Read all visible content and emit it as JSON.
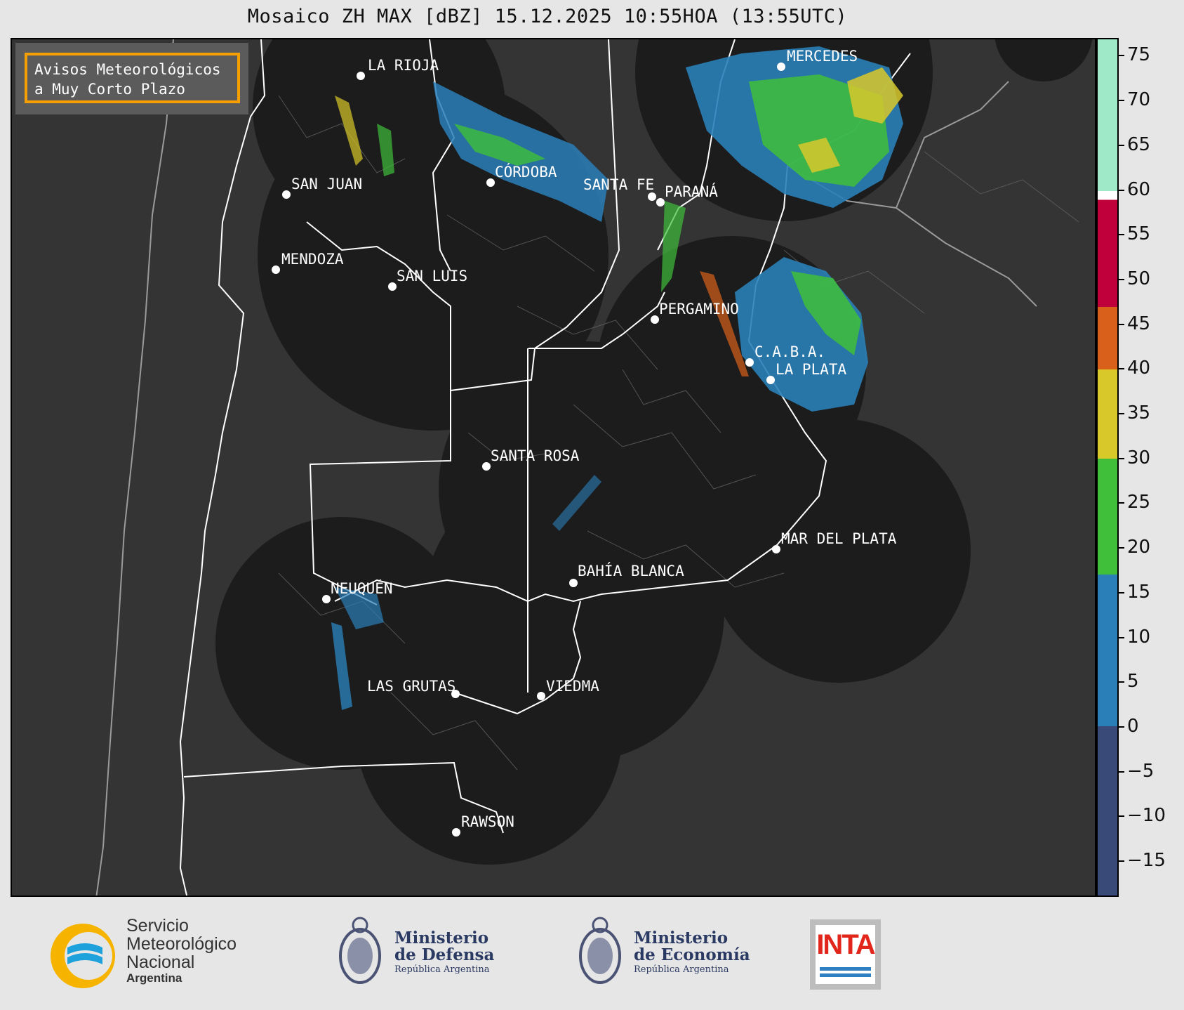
{
  "title": "Mosaico ZH MAX [dBZ] 15.12.2025 10:55HOA (13:55UTC)",
  "warning_box": {
    "line1": "Avisos Meteorológicos",
    "line2": "a Muy Corto Plazo"
  },
  "cities": [
    {
      "name": "LA RIOJA"
    },
    {
      "name": "SAN JUAN"
    },
    {
      "name": "CÓRDOBA"
    },
    {
      "name": "MENDOZA"
    },
    {
      "name": "SAN LUIS"
    },
    {
      "name": "SANTA FE"
    },
    {
      "name": "PARANÁ"
    },
    {
      "name": "MERCEDES"
    },
    {
      "name": "PERGAMINO"
    },
    {
      "name": "C.A.B.A."
    },
    {
      "name": "LA PLATA"
    },
    {
      "name": "SANTA ROSA"
    },
    {
      "name": "MAR DEL PLATA"
    },
    {
      "name": "BAHÍA BLANCA"
    },
    {
      "name": "NEUQUÉN"
    },
    {
      "name": "LAS GRUTAS"
    },
    {
      "name": "VIEDMA"
    },
    {
      "name": "RAWSON"
    }
  ],
  "colorbar": {
    "unit": "dBZ",
    "min": -19,
    "max": 77,
    "ticks": [
      "75",
      "70",
      "65",
      "60",
      "55",
      "50",
      "45",
      "40",
      "35",
      "30",
      "25",
      "20",
      "15",
      "10",
      "5",
      "0",
      "−5",
      "−10",
      "−15"
    ],
    "tick_values": [
      75,
      70,
      65,
      60,
      55,
      50,
      45,
      40,
      35,
      30,
      25,
      20,
      15,
      10,
      5,
      0,
      -5,
      -10,
      -15
    ],
    "bands": [
      {
        "from": -19,
        "to": 0,
        "color": "#3a4a78"
      },
      {
        "from": 0,
        "to": 17,
        "color": "#2a7fb8"
      },
      {
        "from": 17,
        "to": 30,
        "color": "#3fbf3a"
      },
      {
        "from": 30,
        "to": 40,
        "color": "#d8c82a"
      },
      {
        "from": 40,
        "to": 47,
        "color": "#d8601a"
      },
      {
        "from": 47,
        "to": 59,
        "color": "#c0003a"
      },
      {
        "from": 59,
        "to": 60,
        "color": "#ffffff"
      },
      {
        "from": 60,
        "to": 77,
        "color": "#9fe8c8"
      }
    ]
  },
  "logos": {
    "smn_line1": "Servicio",
    "smn_line2": "Meteorológico",
    "smn_line3": "Nacional",
    "smn_line4": "Argentina",
    "defensa_line1": "Ministerio",
    "defensa_line2": "de Defensa",
    "defensa_line3": "República Argentina",
    "economia_line1": "Ministerio",
    "economia_line2": "de Economía",
    "economia_line3": "República Argentina",
    "inta": "INTA"
  },
  "colors": {
    "map_background": "#343434",
    "radar_coverage": "#1c1c1c",
    "accent_box": "#f5a000"
  }
}
